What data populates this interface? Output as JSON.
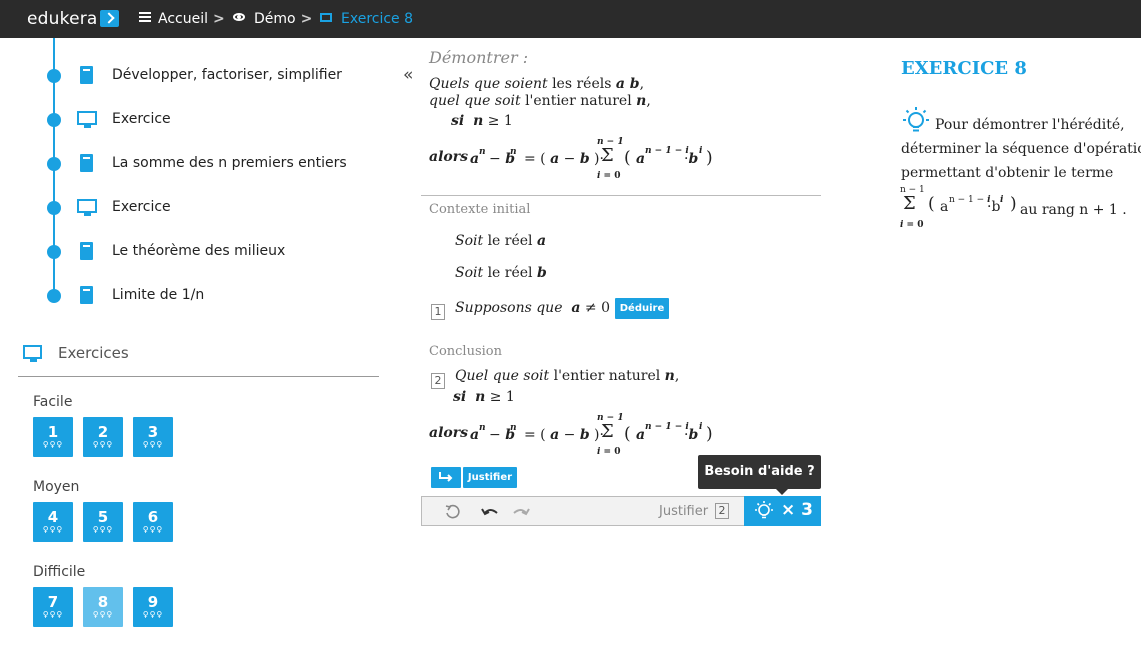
{
  "header": {
    "logo_text": "edukera",
    "crumbs": [
      {
        "label": "Accueil",
        "icon": "menu-icon"
      },
      {
        "label": "Démo",
        "icon": "eye-icon"
      },
      {
        "label": "Exercice 8",
        "icon": "monitor-icon"
      }
    ]
  },
  "sidebar": {
    "items": [
      {
        "label": "Développer, factoriser, simplifier",
        "icon": "book-icon"
      },
      {
        "label": "Exercice",
        "icon": "monitor-icon"
      },
      {
        "label": "La somme des n premiers entiers",
        "icon": "book-icon"
      },
      {
        "label": "Exercice",
        "icon": "monitor-icon"
      },
      {
        "label": "Le théorème des milieux",
        "icon": "book-icon"
      },
      {
        "label": "Limite de 1/n",
        "icon": "book-icon"
      }
    ],
    "exercises_title": "Exercices",
    "levels": [
      {
        "label": "Facile",
        "tiles": [
          "1",
          "2",
          "3"
        ]
      },
      {
        "label": "Moyen",
        "tiles": [
          "4",
          "5",
          "6"
        ]
      },
      {
        "label": "Difficile",
        "tiles": [
          "7",
          "8",
          "9"
        ]
      }
    ],
    "bulbs": "♀♀♀",
    "active_tile": "8"
  },
  "main": {
    "collapse": "«",
    "heading": "Démontrer :",
    "stmt1_a": "Quels que soient",
    "stmt1_b": " les réels ",
    "stmt1_vars": "a b",
    "stmt2_a": "quel que soit",
    "stmt2_b": " l'entier naturel ",
    "stmt2_var": "n",
    "cond_si": "si",
    "cond": "n ≥ 1",
    "alors": "alors",
    "formula_lhs": "a",
    "context_title": "Contexte initial",
    "soit1_word": "Soit",
    "soit1_text": " le réel ",
    "soit1_var": "a",
    "soit2_word": "Soit",
    "soit2_text": " le réel ",
    "soit2_var": "b",
    "step1_num": "1",
    "step1_text": "Supposons que",
    "step1_cond": "a ≠ 0",
    "deduire": "Déduire",
    "conclusion_title": "Conclusion",
    "step2_num": "2",
    "quel": "Quel que soit",
    "quel_rest": " l'entier naturel ",
    "quel_var": "n",
    "justifier": "Justifier",
    "toolbar_justifier": "Justifier",
    "toolbar_num": "2",
    "hints_count": "× 3",
    "tooltip": "Besoin d'aide ?"
  },
  "right": {
    "title": "EXERCICE 8",
    "line1": "Pour démontrer l'hérédité,",
    "line2": "déterminer la séquence d'opérations",
    "line3": "permettant d'obtenir le terme",
    "line4_suffix": "au rang n + 1 ."
  },
  "colors": {
    "accent": "#1aa1e1",
    "topbar": "#2b2b2b"
  }
}
